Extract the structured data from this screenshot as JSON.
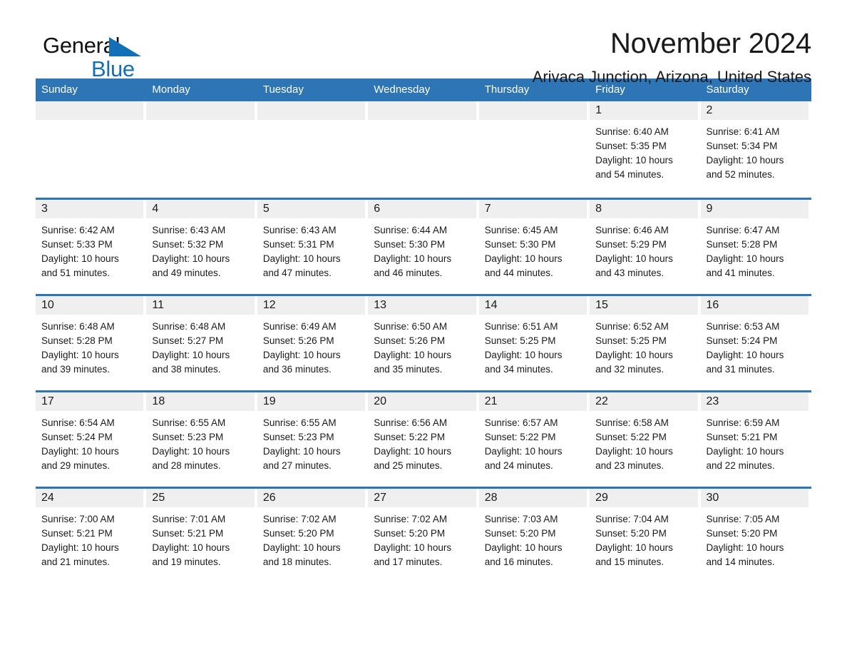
{
  "logo": {
    "word1": "General",
    "word2": "Blue",
    "triangle_color": "#1270b8",
    "icon": "triangle-icon"
  },
  "header": {
    "title": "November 2024",
    "subtitle": "Arivaca Junction, Arizona, United States"
  },
  "theme": {
    "header_blue": "#2e75b6",
    "daynum_gray": "#efefef",
    "text": "#1a1a1a"
  },
  "calendar": {
    "weekday_headers": [
      "Sunday",
      "Monday",
      "Tuesday",
      "Wednesday",
      "Thursday",
      "Friday",
      "Saturday"
    ],
    "weeks": [
      [
        {
          "day": "",
          "empty": true
        },
        {
          "day": "",
          "empty": true
        },
        {
          "day": "",
          "empty": true
        },
        {
          "day": "",
          "empty": true
        },
        {
          "day": "",
          "empty": true
        },
        {
          "day": "1",
          "sunrise": "Sunrise: 6:40 AM",
          "sunset": "Sunset: 5:35 PM",
          "daylight1": "Daylight: 10 hours",
          "daylight2": "and 54 minutes."
        },
        {
          "day": "2",
          "sunrise": "Sunrise: 6:41 AM",
          "sunset": "Sunset: 5:34 PM",
          "daylight1": "Daylight: 10 hours",
          "daylight2": "and 52 minutes."
        }
      ],
      [
        {
          "day": "3",
          "sunrise": "Sunrise: 6:42 AM",
          "sunset": "Sunset: 5:33 PM",
          "daylight1": "Daylight: 10 hours",
          "daylight2": "and 51 minutes."
        },
        {
          "day": "4",
          "sunrise": "Sunrise: 6:43 AM",
          "sunset": "Sunset: 5:32 PM",
          "daylight1": "Daylight: 10 hours",
          "daylight2": "and 49 minutes."
        },
        {
          "day": "5",
          "sunrise": "Sunrise: 6:43 AM",
          "sunset": "Sunset: 5:31 PM",
          "daylight1": "Daylight: 10 hours",
          "daylight2": "and 47 minutes."
        },
        {
          "day": "6",
          "sunrise": "Sunrise: 6:44 AM",
          "sunset": "Sunset: 5:30 PM",
          "daylight1": "Daylight: 10 hours",
          "daylight2": "and 46 minutes."
        },
        {
          "day": "7",
          "sunrise": "Sunrise: 6:45 AM",
          "sunset": "Sunset: 5:30 PM",
          "daylight1": "Daylight: 10 hours",
          "daylight2": "and 44 minutes."
        },
        {
          "day": "8",
          "sunrise": "Sunrise: 6:46 AM",
          "sunset": "Sunset: 5:29 PM",
          "daylight1": "Daylight: 10 hours",
          "daylight2": "and 43 minutes."
        },
        {
          "day": "9",
          "sunrise": "Sunrise: 6:47 AM",
          "sunset": "Sunset: 5:28 PM",
          "daylight1": "Daylight: 10 hours",
          "daylight2": "and 41 minutes."
        }
      ],
      [
        {
          "day": "10",
          "sunrise": "Sunrise: 6:48 AM",
          "sunset": "Sunset: 5:28 PM",
          "daylight1": "Daylight: 10 hours",
          "daylight2": "and 39 minutes."
        },
        {
          "day": "11",
          "sunrise": "Sunrise: 6:48 AM",
          "sunset": "Sunset: 5:27 PM",
          "daylight1": "Daylight: 10 hours",
          "daylight2": "and 38 minutes."
        },
        {
          "day": "12",
          "sunrise": "Sunrise: 6:49 AM",
          "sunset": "Sunset: 5:26 PM",
          "daylight1": "Daylight: 10 hours",
          "daylight2": "and 36 minutes."
        },
        {
          "day": "13",
          "sunrise": "Sunrise: 6:50 AM",
          "sunset": "Sunset: 5:26 PM",
          "daylight1": "Daylight: 10 hours",
          "daylight2": "and 35 minutes."
        },
        {
          "day": "14",
          "sunrise": "Sunrise: 6:51 AM",
          "sunset": "Sunset: 5:25 PM",
          "daylight1": "Daylight: 10 hours",
          "daylight2": "and 34 minutes."
        },
        {
          "day": "15",
          "sunrise": "Sunrise: 6:52 AM",
          "sunset": "Sunset: 5:25 PM",
          "daylight1": "Daylight: 10 hours",
          "daylight2": "and 32 minutes."
        },
        {
          "day": "16",
          "sunrise": "Sunrise: 6:53 AM",
          "sunset": "Sunset: 5:24 PM",
          "daylight1": "Daylight: 10 hours",
          "daylight2": "and 31 minutes."
        }
      ],
      [
        {
          "day": "17",
          "sunrise": "Sunrise: 6:54 AM",
          "sunset": "Sunset: 5:24 PM",
          "daylight1": "Daylight: 10 hours",
          "daylight2": "and 29 minutes."
        },
        {
          "day": "18",
          "sunrise": "Sunrise: 6:55 AM",
          "sunset": "Sunset: 5:23 PM",
          "daylight1": "Daylight: 10 hours",
          "daylight2": "and 28 minutes."
        },
        {
          "day": "19",
          "sunrise": "Sunrise: 6:55 AM",
          "sunset": "Sunset: 5:23 PM",
          "daylight1": "Daylight: 10 hours",
          "daylight2": "and 27 minutes."
        },
        {
          "day": "20",
          "sunrise": "Sunrise: 6:56 AM",
          "sunset": "Sunset: 5:22 PM",
          "daylight1": "Daylight: 10 hours",
          "daylight2": "and 25 minutes."
        },
        {
          "day": "21",
          "sunrise": "Sunrise: 6:57 AM",
          "sunset": "Sunset: 5:22 PM",
          "daylight1": "Daylight: 10 hours",
          "daylight2": "and 24 minutes."
        },
        {
          "day": "22",
          "sunrise": "Sunrise: 6:58 AM",
          "sunset": "Sunset: 5:22 PM",
          "daylight1": "Daylight: 10 hours",
          "daylight2": "and 23 minutes."
        },
        {
          "day": "23",
          "sunrise": "Sunrise: 6:59 AM",
          "sunset": "Sunset: 5:21 PM",
          "daylight1": "Daylight: 10 hours",
          "daylight2": "and 22 minutes."
        }
      ],
      [
        {
          "day": "24",
          "sunrise": "Sunrise: 7:00 AM",
          "sunset": "Sunset: 5:21 PM",
          "daylight1": "Daylight: 10 hours",
          "daylight2": "and 21 minutes."
        },
        {
          "day": "25",
          "sunrise": "Sunrise: 7:01 AM",
          "sunset": "Sunset: 5:21 PM",
          "daylight1": "Daylight: 10 hours",
          "daylight2": "and 19 minutes."
        },
        {
          "day": "26",
          "sunrise": "Sunrise: 7:02 AM",
          "sunset": "Sunset: 5:20 PM",
          "daylight1": "Daylight: 10 hours",
          "daylight2": "and 18 minutes."
        },
        {
          "day": "27",
          "sunrise": "Sunrise: 7:02 AM",
          "sunset": "Sunset: 5:20 PM",
          "daylight1": "Daylight: 10 hours",
          "daylight2": "and 17 minutes."
        },
        {
          "day": "28",
          "sunrise": "Sunrise: 7:03 AM",
          "sunset": "Sunset: 5:20 PM",
          "daylight1": "Daylight: 10 hours",
          "daylight2": "and 16 minutes."
        },
        {
          "day": "29",
          "sunrise": "Sunrise: 7:04 AM",
          "sunset": "Sunset: 5:20 PM",
          "daylight1": "Daylight: 10 hours",
          "daylight2": "and 15 minutes."
        },
        {
          "day": "30",
          "sunrise": "Sunrise: 7:05 AM",
          "sunset": "Sunset: 5:20 PM",
          "daylight1": "Daylight: 10 hours",
          "daylight2": "and 14 minutes."
        }
      ]
    ]
  }
}
